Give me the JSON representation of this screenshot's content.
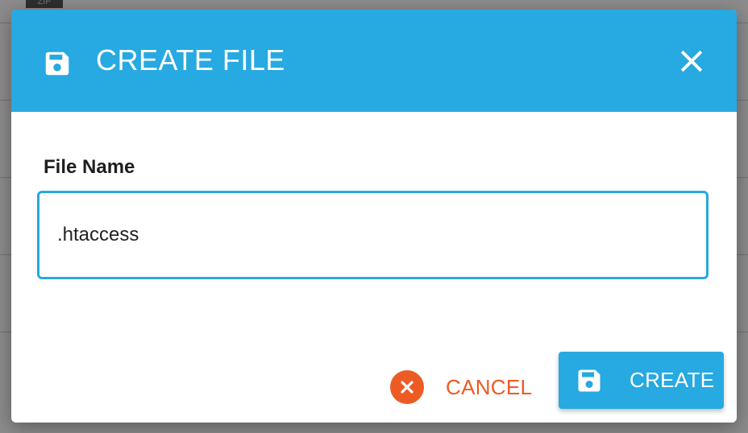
{
  "background": {
    "zip_badge": "ZIP"
  },
  "dialog": {
    "title": "CREATE FILE",
    "header_icon": "save-icon",
    "close_icon": "close-icon",
    "field": {
      "label": "File Name",
      "value": ".htaccess"
    },
    "buttons": {
      "cancel_label": "CANCEL",
      "cancel_icon": "cancel-circle-icon",
      "create_label": "CREATE",
      "create_icon": "save-icon"
    },
    "colors": {
      "header": "#27a9e1",
      "primary": "#27a9e1",
      "danger": "#ee5a24"
    }
  }
}
